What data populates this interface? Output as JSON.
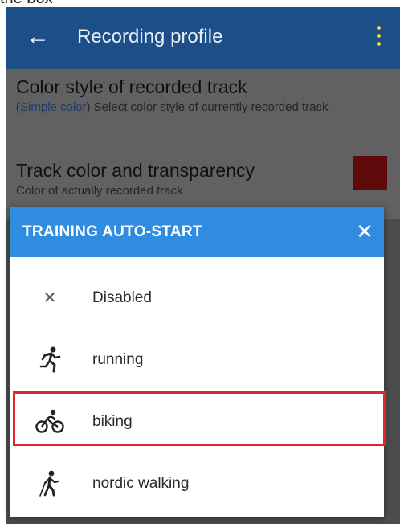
{
  "caption": "the box",
  "appbar": {
    "title": "Recording profile",
    "back_icon": "arrow-left-icon",
    "menu_icon": "more-vert-icon"
  },
  "settings": [
    {
      "title": "Color style of recorded track",
      "desc_link": "Simple color",
      "desc": "Select color style of currently recorded track"
    },
    {
      "title": "Track color and transparency",
      "desc": "Color of actually recorded track",
      "swatch_color": "#9a1111"
    }
  ],
  "dialog": {
    "title": "TRAINING AUTO-START",
    "close_icon": "close-icon",
    "options": [
      {
        "label": "Disabled",
        "icon": "close-icon"
      },
      {
        "label": "running",
        "icon": "running-icon"
      },
      {
        "label": "biking",
        "icon": "bicycle-icon",
        "highlighted": true
      },
      {
        "label": "nordic walking",
        "icon": "nordic-walking-icon"
      }
    ]
  },
  "colors": {
    "appbar": "#1c4f88",
    "dialog_header": "#2f8ce0",
    "highlight": "#e0262b",
    "link": "#2b64b0"
  }
}
